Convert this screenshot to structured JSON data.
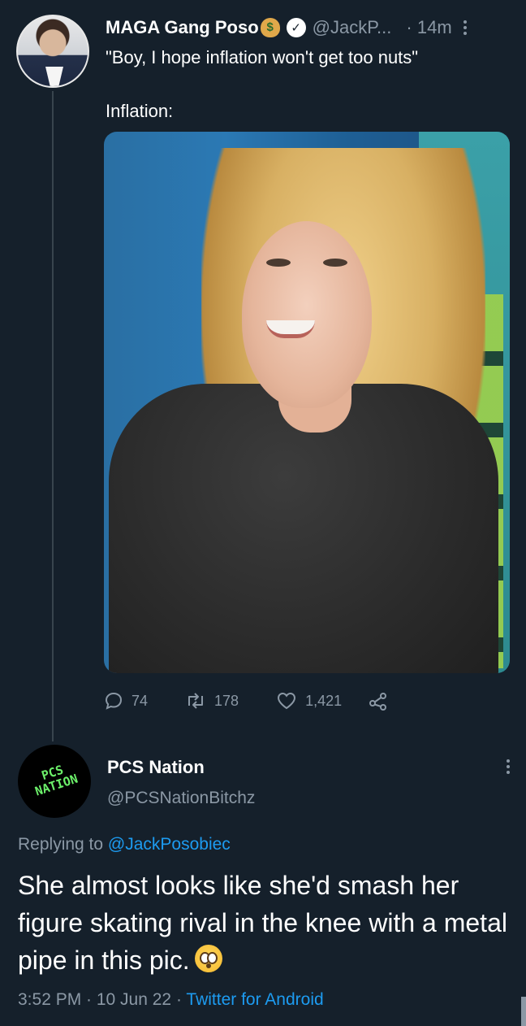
{
  "tweet1": {
    "author_name": "MAGA Gang Poso",
    "author_handle": "@JackP...",
    "separator": "·",
    "time": "14m",
    "text_line1": "\"Boy, I hope inflation won't get too nuts\"",
    "text_line2": "Inflation:",
    "actions": {
      "replies": "74",
      "retweets": "178",
      "likes": "1,421"
    }
  },
  "tweet2": {
    "author_name": "PCS Nation",
    "author_handle": "@PCSNationBitchz",
    "avatar_text_line1": "PCS",
    "avatar_text_line2": "NATION",
    "replying_prefix": "Replying to",
    "replying_to": "@JackPosobiec",
    "body": "She almost looks like she'd smash her figure skating rival in the knee with a metal pipe in this pic.",
    "meta_time": "3:52 PM · 10 Jun 22 ·",
    "meta_source": "Twitter for Android"
  },
  "icons": {
    "verified": "verified-badge-icon",
    "moneybag": "money-bag-emoji",
    "reply": "reply-icon",
    "retweet": "retweet-icon",
    "like": "heart-icon",
    "share": "share-icon",
    "more": "more-vertical-icon",
    "flushed": "flushed-face-emoji"
  },
  "colors": {
    "background": "#15202b",
    "secondary_text": "#8b98a5",
    "link": "#1d9bf0",
    "avatar2_logo": "#6cf06a"
  }
}
